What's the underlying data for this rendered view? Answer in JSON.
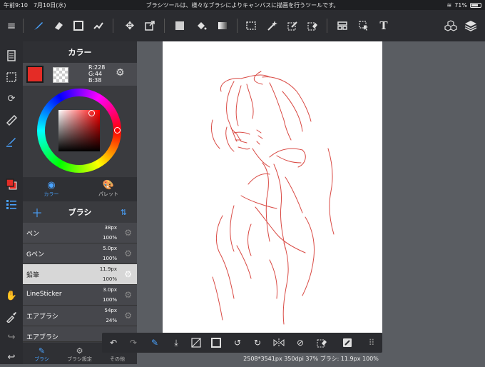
{
  "status_bar": {
    "time": "午前9:10　7月10日(水)",
    "title": "ブラシツールは、様々なブラシによりキャンバスに描画を行うツールです。",
    "battery": "71%",
    "battery_level": 0.71
  },
  "toolbar": {
    "icons": [
      "menu-icon",
      "brush-icon",
      "eraser-icon",
      "square-icon",
      "dot-icon",
      "move-icon",
      "transform-icon",
      "fill-color-icon",
      "bucket-icon",
      "gradient-icon",
      "select-rect-icon",
      "magic-wand-icon",
      "select-pen-icon",
      "select-eraser-icon",
      "frame-icon",
      "pointer-icon",
      "text-icon",
      "material-icon",
      "layer-icon"
    ]
  },
  "color_panel": {
    "title": "カラー",
    "current_color": "#e42c26",
    "r": "R:228",
    "g": "G:44",
    "b": "B:38"
  },
  "mode_tabs": {
    "color_label": "カラー",
    "palette_label": "パレット"
  },
  "brush_panel": {
    "title": "ブラシ",
    "brushes": [
      {
        "name": "ペン",
        "size": "38px",
        "opacity": "100%"
      },
      {
        "name": "Gペン",
        "size": "5.0px",
        "opacity": "100%"
      },
      {
        "name": "鉛筆",
        "size": "11.9px",
        "opacity": "100%"
      },
      {
        "name": "LineSticker",
        "size": "3.0px",
        "opacity": "100%"
      },
      {
        "name": "エアブラシ",
        "size": "54px",
        "opacity": "24%"
      },
      {
        "name": "エアブラシ",
        "size": "",
        "opacity": ""
      }
    ],
    "selected_index": 2
  },
  "bottom_tabs": {
    "brush": "ブラシ",
    "brush_settings": "ブラシ設定",
    "other": "その他"
  },
  "canvas_status": "2508*3541px 350dpi 37% ブラシ: 11.9px 100%"
}
